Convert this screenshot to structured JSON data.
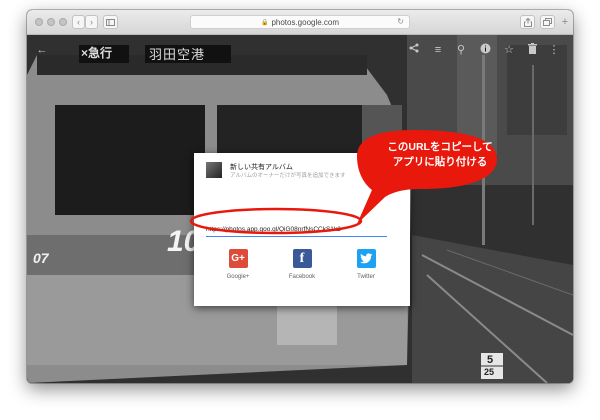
{
  "browser": {
    "address": "photos.google.com"
  },
  "photo": {
    "sign_left": "×急行",
    "sign_right": "羽田空港",
    "car_number_partial": "10",
    "side_number": "07",
    "track_marker_top": "5",
    "track_marker_bottom": "25"
  },
  "dialog": {
    "title": "新しい共有アルバム",
    "description": "アルバムのオーナーだけが写真を追加できます",
    "url": "https://photos.app.goo.gl/QiG08nrfNsCCkS1k2",
    "share_buttons": [
      {
        "label": "Google+",
        "icon": "google-plus-icon",
        "glyph": "G+",
        "color": "#dd4b39"
      },
      {
        "label": "Facebook",
        "icon": "facebook-icon",
        "glyph": "f",
        "color": "#3b5998"
      },
      {
        "label": "Twitter",
        "icon": "twitter-icon",
        "glyph": "❧",
        "color": "#1da1f2"
      }
    ]
  },
  "annotation": {
    "line1": "このURLをコピーして",
    "line2": "アプリに貼り付ける",
    "color": "#e8180c"
  }
}
